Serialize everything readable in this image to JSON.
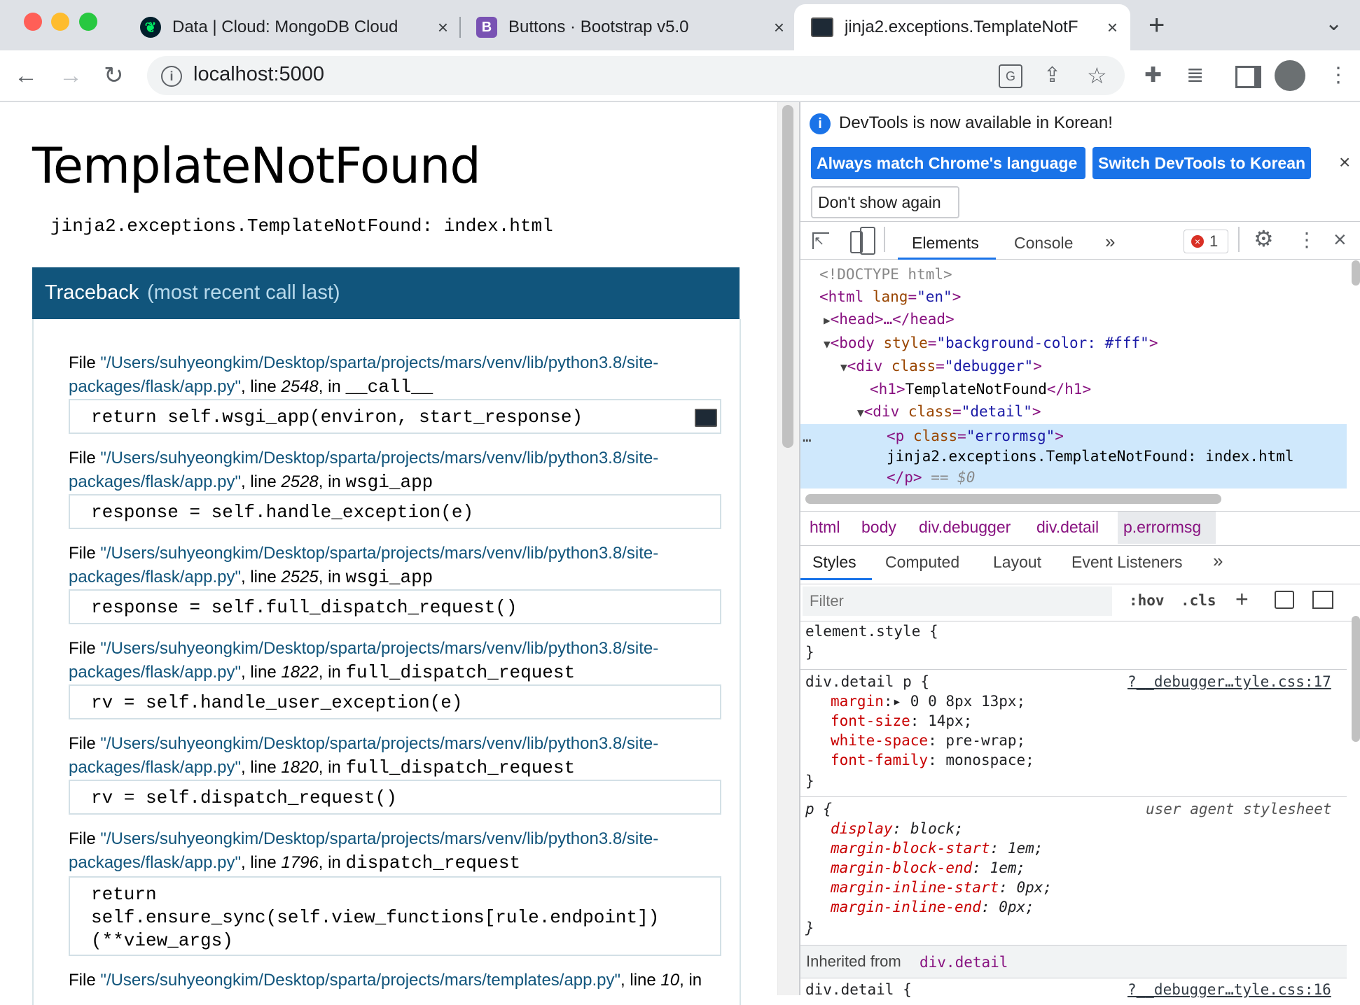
{
  "tabs": [
    {
      "title": "Data | Cloud: MongoDB Cloud",
      "close": "×",
      "favicon": "mongodb-leaf-icon"
    },
    {
      "title": "Buttons · Bootstrap v5.0",
      "close": "×",
      "favicon": "B"
    },
    {
      "title": "jinja2.exceptions.TemplateNotF",
      "close": "×",
      "favicon": "terminal-icon"
    }
  ],
  "new_tab": "+",
  "tab_menu": "⌄",
  "address": {
    "url": "localhost:5000"
  },
  "page": {
    "title": "TemplateNotFound",
    "errormsg": "jinja2.exceptions.TemplateNotFound: index.html",
    "traceback_label": "Traceback",
    "traceback_note": "(most recent call last)",
    "frames": [
      {
        "file_prefix": "File ",
        "path1": "\"/Users/suhyeongkim/Desktop/sparta/projects/mars/venv/lib/python3.8/site-",
        "path2": "packages/flask/app.py\"",
        "line_label": ", line ",
        "line": "2548",
        "in": ", in ",
        "func": "__call__",
        "code": "return self.wsgi_app(environ, start_response)"
      },
      {
        "file_prefix": "File ",
        "path1": "\"/Users/suhyeongkim/Desktop/sparta/projects/mars/venv/lib/python3.8/site-",
        "path2": "packages/flask/app.py\"",
        "line_label": ", line ",
        "line": "2528",
        "in": ", in ",
        "func": "wsgi_app",
        "code": "response = self.handle_exception(e)"
      },
      {
        "file_prefix": "File ",
        "path1": "\"/Users/suhyeongkim/Desktop/sparta/projects/mars/venv/lib/python3.8/site-",
        "path2": "packages/flask/app.py\"",
        "line_label": ", line ",
        "line": "2525",
        "in": ", in ",
        "func": "wsgi_app",
        "code": "response = self.full_dispatch_request()"
      },
      {
        "file_prefix": "File ",
        "path1": "\"/Users/suhyeongkim/Desktop/sparta/projects/mars/venv/lib/python3.8/site-",
        "path2": "packages/flask/app.py\"",
        "line_label": ", line ",
        "line": "1822",
        "in": ", in ",
        "func": "full_dispatch_request",
        "code": "rv = self.handle_user_exception(e)"
      },
      {
        "file_prefix": "File ",
        "path1": "\"/Users/suhyeongkim/Desktop/sparta/projects/mars/venv/lib/python3.8/site-",
        "path2": "packages/flask/app.py\"",
        "line_label": ", line ",
        "line": "1820",
        "in": ", in ",
        "func": "full_dispatch_request",
        "code": "rv = self.dispatch_request()"
      },
      {
        "file_prefix": "File ",
        "path1": "\"/Users/suhyeongkim/Desktop/sparta/projects/mars/venv/lib/python3.8/site-",
        "path2": "packages/flask/app.py\"",
        "line_label": ", line ",
        "line": "1796",
        "in": ", in ",
        "func": "dispatch_request",
        "code": "return\nself.ensure_sync(self.view_functions[rule.endpoint])\n(**view_args)"
      },
      {
        "file_prefix": "File ",
        "path1": "\"/Users/suhyeongkim/Desktop/sparta/projects/mars/templates/app.py\"",
        "path2": "",
        "line_label": ", line ",
        "line": "10",
        "in": ", in",
        "func": "",
        "code": ""
      }
    ]
  },
  "devtools": {
    "info": "DevTools is now available in Korean!",
    "btn_match": "Always match Chrome's language",
    "btn_switch": "Switch DevTools to Korean",
    "btn_dont": "Don't show again",
    "close": "×",
    "tabs": {
      "elements": "Elements",
      "console": "Console",
      "more": "»"
    },
    "error_count": "1",
    "dom": {
      "doctype": "<!DOCTYPE html>",
      "html_open": "<html",
      "lang_attr": "lang",
      "lang_val": "\"en\"",
      "head": "<head>…</head>",
      "body_tag": "<body",
      "body_attr": "style",
      "body_val": "\"background-color: #fff\"",
      "div_debugger_tag": "<div",
      "class_attr": "class",
      "debugger_val": "\"debugger\"",
      "h1_open": "<h1>",
      "h1_text": "TemplateNotFound",
      "h1_close": "</h1>",
      "detail_val": "\"detail\"",
      "p_tag": "<p",
      "errormsg_val": "\"errormsg\"",
      "p_text": "jinja2.exceptions.TemplateNotFound: index.html",
      "p_close": "</p>",
      "eq": " == $0",
      "ellipsis": "…"
    },
    "breadcrumbs": [
      "html",
      "body",
      "div.debugger",
      "div.detail",
      "p.errormsg"
    ],
    "style_tabs": [
      "Styles",
      "Computed",
      "Layout",
      "Event Listeners",
      "»"
    ],
    "filter_placeholder": "Filter",
    "hov": ":hov",
    "cls": ".cls",
    "rules": {
      "element_style": "element.style {",
      "close_brace": "}",
      "detail_p_sel": "div.detail p {",
      "detail_p_src": "?__debugger…tyle.css:17",
      "decls1": [
        {
          "p": "margin",
          "v": "▸ 0 0 8px 13px;"
        },
        {
          "p": "font-size",
          "v": " 14px;"
        },
        {
          "p": "white-space",
          "v": " pre-wrap;"
        },
        {
          "p": "font-family",
          "v": " monospace;"
        }
      ],
      "p_sel": "p {",
      "p_src": "user agent stylesheet",
      "decls2": [
        {
          "p": "display",
          "v": " block;"
        },
        {
          "p": "margin-block-start",
          "v": " 1em;"
        },
        {
          "p": "margin-block-end",
          "v": " 1em;"
        },
        {
          "p": "margin-inline-start",
          "v": " 0px;"
        },
        {
          "p": "margin-inline-end",
          "v": " 0px;"
        }
      ],
      "inherited_label": "Inherited from ",
      "inherited_from": "div.detail",
      "detail_sel2": "div.detail {",
      "detail_src2": "?__debugger…tyle.css:16"
    }
  },
  "colors": {
    "traceback_bg": "#11557c",
    "tab_strip": "#dee1e6",
    "devtools_blue": "#1a73e8",
    "selected_row": "#cfe8fc"
  }
}
